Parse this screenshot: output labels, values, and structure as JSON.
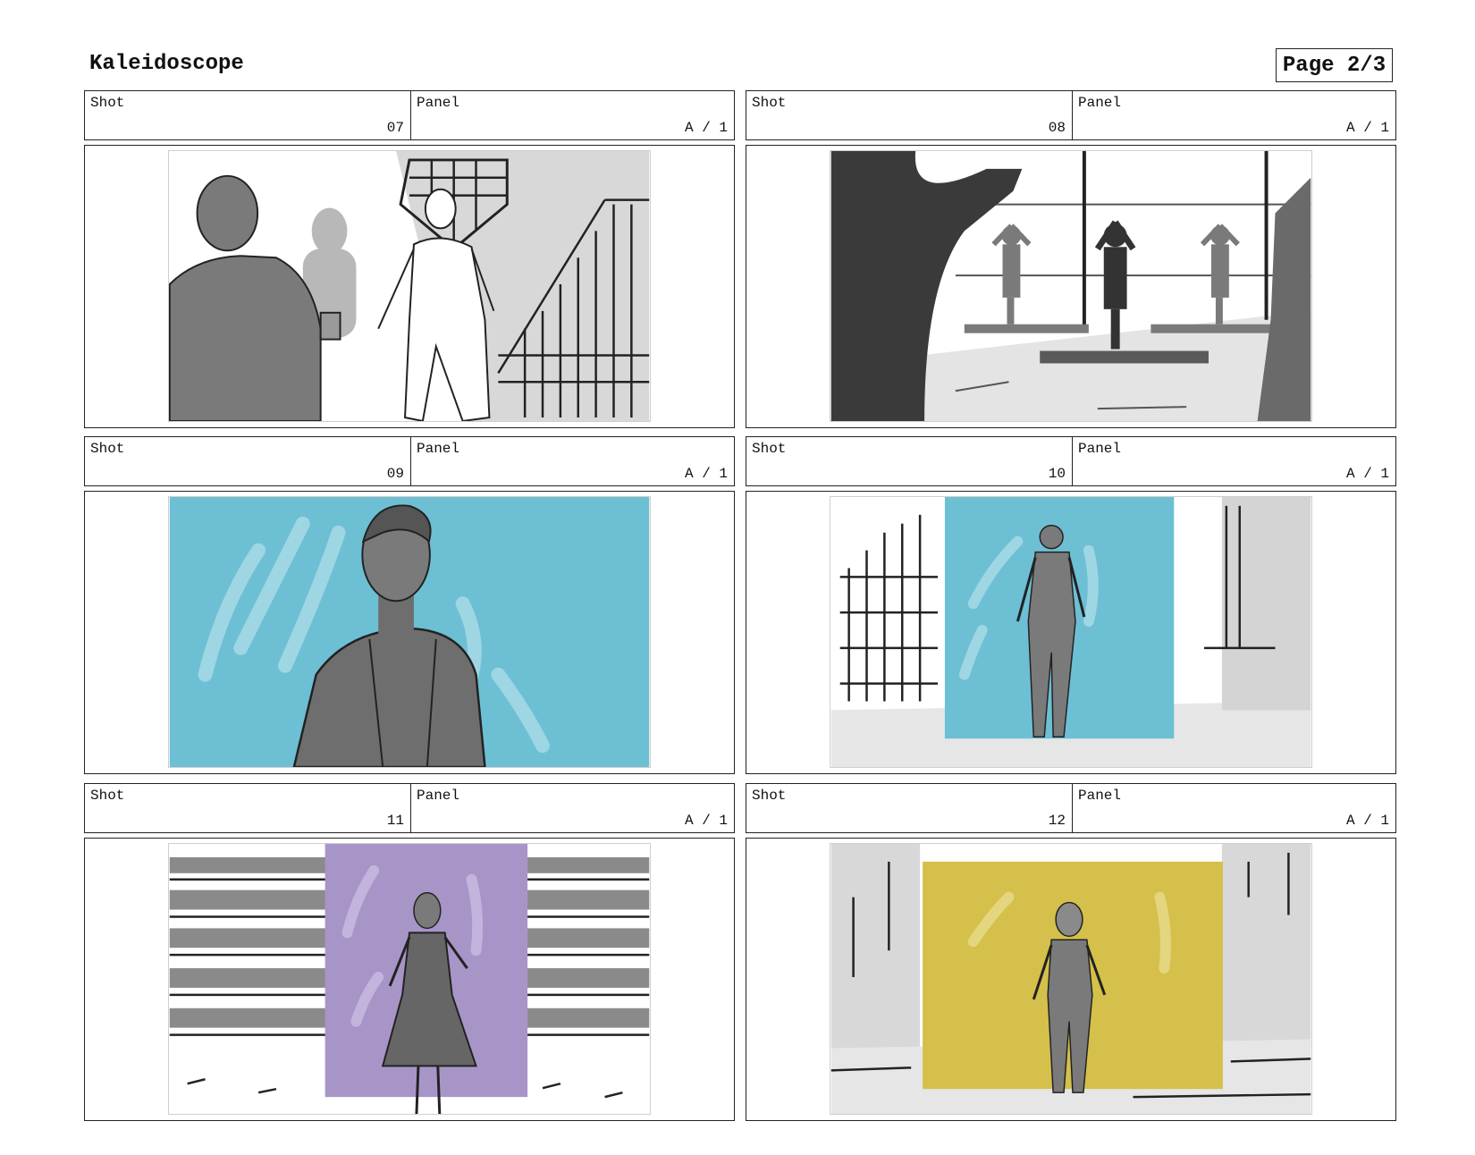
{
  "header": {
    "title": "Kaleidoscope",
    "page": "Page 2/3"
  },
  "labels": {
    "shot": "Shot",
    "panel": "Panel"
  },
  "shots": [
    {
      "shot": "07",
      "panel": "A / 1",
      "accent": "#7a7a7a"
    },
    {
      "shot": "08",
      "panel": "A / 1",
      "accent": "#3a3a3a"
    },
    {
      "shot": "09",
      "panel": "A / 1",
      "accent": "#6dbfd4"
    },
    {
      "shot": "10",
      "panel": "A / 1",
      "accent": "#6dbfd4"
    },
    {
      "shot": "11",
      "panel": "A / 1",
      "accent": "#a895c8"
    },
    {
      "shot": "12",
      "panel": "A / 1",
      "accent": "#d4c04a"
    }
  ]
}
